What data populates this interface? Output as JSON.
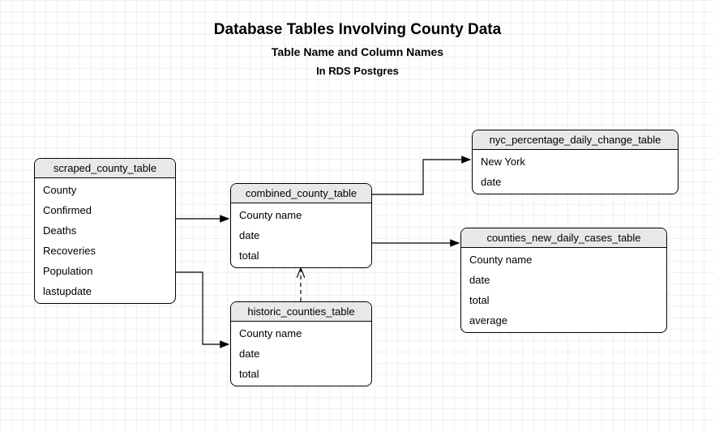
{
  "titles": {
    "main": "Database Tables Involving County Data",
    "sub1": "Table Name and Column Names",
    "sub2": "In RDS Postgres"
  },
  "tables": {
    "scraped": {
      "name": "scraped_county_table",
      "cols": [
        "County",
        "Confirmed",
        "Deaths",
        "Recoveries",
        "Population",
        "lastupdate"
      ]
    },
    "combined": {
      "name": "combined_county_table",
      "cols": [
        "County name",
        "date",
        "total"
      ]
    },
    "historic": {
      "name": "historic_counties_table",
      "cols": [
        "County name",
        "date",
        "total"
      ]
    },
    "nyc": {
      "name": "nyc_percentage_daily_change_table",
      "cols": [
        "New York",
        "date"
      ]
    },
    "newcases": {
      "name": "counties_new_daily_cases_table",
      "cols": [
        "County name",
        "date",
        "total",
        "average"
      ]
    }
  },
  "chart_data": {
    "type": "table",
    "title": "Database Tables Involving County Data",
    "subtitle": "Table Name and Column Names — In RDS Postgres",
    "entities": [
      {
        "id": "scraped_county_table",
        "columns": [
          "County",
          "Confirmed",
          "Deaths",
          "Recoveries",
          "Population",
          "lastupdate"
        ]
      },
      {
        "id": "combined_county_table",
        "columns": [
          "County name",
          "date",
          "total"
        ]
      },
      {
        "id": "historic_counties_table",
        "columns": [
          "County name",
          "date",
          "total"
        ]
      },
      {
        "id": "nyc_percentage_daily_change_table",
        "columns": [
          "New York",
          "date"
        ]
      },
      {
        "id": "counties_new_daily_cases_table",
        "columns": [
          "County name",
          "date",
          "total",
          "average"
        ]
      }
    ],
    "edges": [
      {
        "from": "scraped_county_table",
        "to": "combined_county_table",
        "style": "solid"
      },
      {
        "from": "scraped_county_table",
        "to": "historic_counties_table",
        "style": "solid"
      },
      {
        "from": "historic_counties_table",
        "to": "combined_county_table",
        "style": "dashed"
      },
      {
        "from": "combined_county_table",
        "to": "nyc_percentage_daily_change_table",
        "style": "solid"
      },
      {
        "from": "combined_county_table",
        "to": "counties_new_daily_cases_table",
        "style": "solid"
      }
    ]
  }
}
